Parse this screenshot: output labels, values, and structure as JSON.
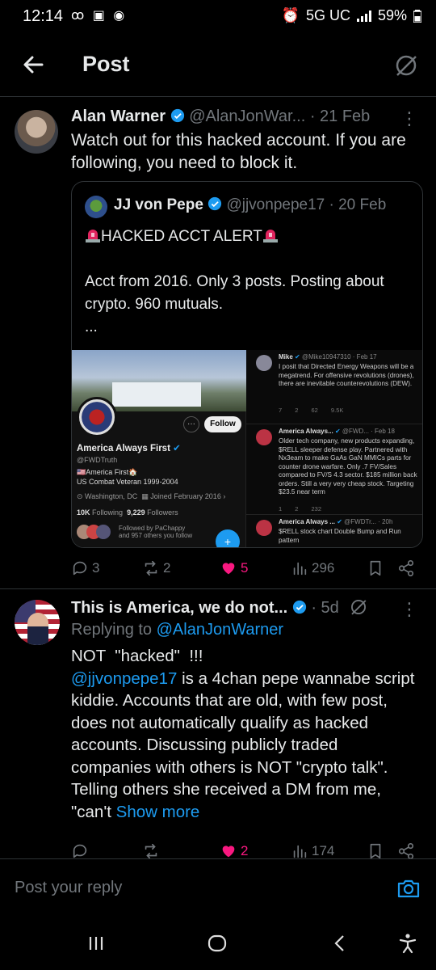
{
  "status_bar": {
    "time": "12:14",
    "network": "5G UC",
    "battery": "59%"
  },
  "header": {
    "title": "Post"
  },
  "tweet1": {
    "name": "Alan Warner",
    "handle": "@AlanJonWar...",
    "date": "· 21 Feb",
    "text": "Watch out for this hacked account. If you are following, you need to block it.",
    "quote": {
      "name": "JJ von Pepe",
      "handle": "@jjvonpepe17",
      "date": "· 20 Feb",
      "title": "HACKED ACCT ALERT",
      "body": "Acct from 2016. Only 3 posts. Posting about crypto. 960 mutuals.",
      "ellipsis": "...",
      "screenshot": {
        "profile_name": "America Always First",
        "profile_handle": "@FWDTruth",
        "follow_label": "Follow",
        "bio1": "🇺🇸America First🏠",
        "bio2": "US Combat Veteran 1999-2004",
        "location": "Washington, DC",
        "joined": "Joined February 2016",
        "following": "10K",
        "following_label": "Following",
        "followers": "9,229",
        "followers_label": "Followers",
        "followed_by": "Followed by PaChappy",
        "followed_by2": "and 957 others you follow",
        "feed": [
          {
            "name": "Mike",
            "meta": "@Mike10947310 · Feb 17",
            "text": "I posit that Directed Energy Weapons will be a megatrend. For offensive revolutions (drones), there are inevitable counterevolutions (DEW).",
            "stats": "7 2 62 9.5K"
          },
          {
            "name": "America Always...",
            "meta": "@FWD... · Feb 18",
            "text": "Older tech company, new products expanding, $RELL sleeper defense play. Partnered with Nx3eam to make GaAs GaN MMICs parts for counter drone warfare. Only .7 FV/Sales compared to FV/S 4.3 sector. $185 million back orders. Still a very very cheap stock. Targeting $23.5 near term",
            "stats": "1 2 232"
          },
          {
            "name": "America Always ...",
            "meta": "@FWDTr... · 20h",
            "text": "$RELL stock chart Double Bump and Run pattern",
            "stats": ""
          }
        ]
      }
    },
    "actions": {
      "replies": "3",
      "reposts": "2",
      "likes": "5",
      "views": "296"
    }
  },
  "tweet2": {
    "name": "This is America, we do not...",
    "date": "· 5d",
    "replying_prefix": "Replying to ",
    "replying_handle": "@AlanJonWarner",
    "line1": "NOT  \"hacked\"  !!!",
    "mention": "@jjvonpepe17",
    "body": " is a 4chan pepe wannabe script kiddie. Accounts that are old, with few post, does not automatically qualify as hacked accounts. Discussing publicly traded companies with others is NOT \"crypto talk\". Telling others she received a DM from me, \"can't ",
    "show_more": "Show more",
    "actions": {
      "replies": "",
      "reposts": "",
      "likes": "2",
      "views": "174"
    }
  },
  "reply_input": {
    "placeholder": "Post your reply"
  },
  "colors": {
    "background": "#000000",
    "accent": "#1d9bf0",
    "like": "#f91880",
    "muted": "#71767b"
  }
}
